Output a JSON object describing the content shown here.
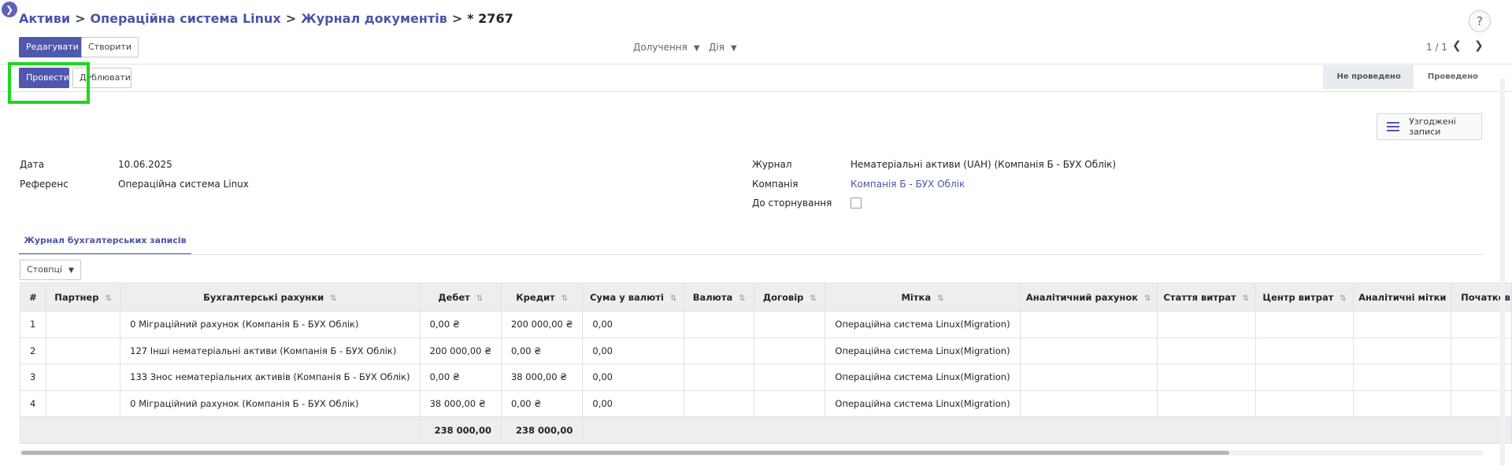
{
  "breadcrumb": {
    "items": [
      "Активи",
      "Операційна система Linux",
      "Журнал документів"
    ],
    "current": "* 2767"
  },
  "help_label": "?",
  "toolbar": {
    "edit_label": "Редагувати",
    "create_label": "Створити",
    "attachments_label": "Долучення",
    "action_label": "Дія",
    "pager_value": "1 / 1"
  },
  "status_actions": {
    "post_label": "Провести",
    "duplicate_label": "Дублювати"
  },
  "statusbar": {
    "steps": [
      "Не проведено",
      "Проведено"
    ]
  },
  "smart_button": {
    "label": "Узгоджені записи"
  },
  "form": {
    "date_label": "Дата",
    "date_value": "10.06.2025",
    "ref_label": "Референс",
    "ref_value": "Операційна система Linux",
    "journal_label": "Журнал",
    "journal_value": "Нематеріальні активи (UAH) (Компанія Б - БУХ Облік)",
    "company_label": "Компанія",
    "company_value": "Компанія Б - БУХ Облік",
    "reverse_label": "До сторнування"
  },
  "tab": {
    "label": "Журнал бухгалтерських записів"
  },
  "columns_button": "Стовпці",
  "table": {
    "headers": [
      "#",
      "Партнер",
      "Бухгалтерські рахунки",
      "Дебет",
      "Кредит",
      "Сума у валюті",
      "Валюта",
      "Договір",
      "Мітка",
      "Аналітичний рахунок",
      "Стаття витрат",
      "Центр витрат",
      "Аналітичні мітки",
      "Початков"
    ],
    "rows": [
      {
        "n": "1",
        "partner": "",
        "account": "0 Міграційний рахунок (Компанія Б - БУХ Облік)",
        "debit": "0,00 ₴",
        "credit": "200 000,00 ₴",
        "amount_currency": "0,00",
        "label": "Операційна система Linux(Migration)"
      },
      {
        "n": "2",
        "partner": "",
        "account": "127 Інші нематеріальні активи (Компанія Б - БУХ Облік)",
        "debit": "200 000,00 ₴",
        "credit": "0,00 ₴",
        "amount_currency": "0,00",
        "label": "Операційна система Linux(Migration)"
      },
      {
        "n": "3",
        "partner": "",
        "account": "133 Знос нематеріальних активів (Компанія Б - БУХ Облік)",
        "debit": "0,00 ₴",
        "credit": "38 000,00 ₴",
        "amount_currency": "0,00",
        "label": "Операційна система Linux(Migration)"
      },
      {
        "n": "4",
        "partner": "",
        "account": "0 Міграційний рахунок (Компанія Б - БУХ Облік)",
        "debit": "38 000,00 ₴",
        "credit": "0,00 ₴",
        "amount_currency": "0,00",
        "label": "Операційна система Linux(Migration)"
      }
    ],
    "total_debit": "238 000,00",
    "total_credit": "238 000,00"
  },
  "colors": {
    "accent": "#4f58ad",
    "highlight": "#21d61f"
  }
}
